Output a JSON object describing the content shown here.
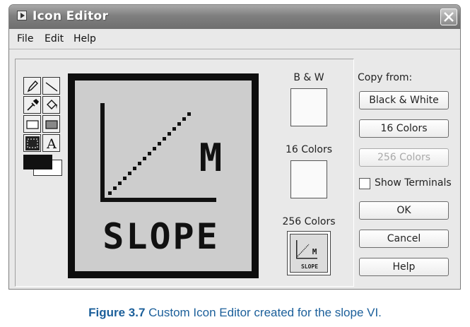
{
  "window": {
    "title": "Icon Editor"
  },
  "menu": [
    "File",
    "Edit",
    "Help"
  ],
  "tools": [
    {
      "icon": "pencil-icon"
    },
    {
      "icon": "line-icon"
    },
    {
      "icon": "eyedropper-icon"
    },
    {
      "icon": "fill-bucket-icon"
    },
    {
      "icon": "rectangle-icon"
    },
    {
      "icon": "filled-rectangle-icon"
    },
    {
      "icon": "select-icon"
    },
    {
      "icon": "text-icon",
      "glyph": "A"
    }
  ],
  "colors": {
    "foreground": "#111111",
    "background": "#ffffff",
    "caption": "#1b5f9a"
  },
  "canvas": {
    "letter": "M",
    "word": "SLOPE"
  },
  "previews": {
    "bw_label": "B & W",
    "c16_label": "16 Colors",
    "c256_label": "256 Colors",
    "mini_letter": "M",
    "mini_word": "SLOPE"
  },
  "copy_from": {
    "label": "Copy from:",
    "black_white": "Black & White",
    "colors16": "16 Colors",
    "colors256": "256 Colors"
  },
  "show_terminals": {
    "label": "Show Terminals",
    "checked": false
  },
  "buttons": {
    "ok": "OK",
    "cancel": "Cancel",
    "help": "Help"
  },
  "caption": {
    "prefix": "Figure 3.7",
    "text": " Custom Icon Editor created for the slope VI."
  }
}
